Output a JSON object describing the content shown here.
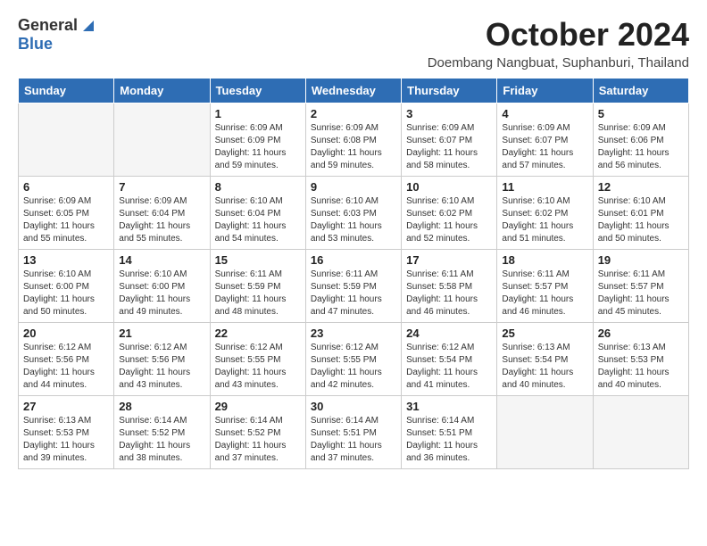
{
  "header": {
    "logo_general": "General",
    "logo_blue": "Blue",
    "month_title": "October 2024",
    "subtitle": "Doembang Nangbuat, Suphanburi, Thailand"
  },
  "weekdays": [
    "Sunday",
    "Monday",
    "Tuesday",
    "Wednesday",
    "Thursday",
    "Friday",
    "Saturday"
  ],
  "weeks": [
    [
      {
        "day": "",
        "info": ""
      },
      {
        "day": "",
        "info": ""
      },
      {
        "day": "1",
        "info": "Sunrise: 6:09 AM\nSunset: 6:09 PM\nDaylight: 11 hours\nand 59 minutes."
      },
      {
        "day": "2",
        "info": "Sunrise: 6:09 AM\nSunset: 6:08 PM\nDaylight: 11 hours\nand 59 minutes."
      },
      {
        "day": "3",
        "info": "Sunrise: 6:09 AM\nSunset: 6:07 PM\nDaylight: 11 hours\nand 58 minutes."
      },
      {
        "day": "4",
        "info": "Sunrise: 6:09 AM\nSunset: 6:07 PM\nDaylight: 11 hours\nand 57 minutes."
      },
      {
        "day": "5",
        "info": "Sunrise: 6:09 AM\nSunset: 6:06 PM\nDaylight: 11 hours\nand 56 minutes."
      }
    ],
    [
      {
        "day": "6",
        "info": "Sunrise: 6:09 AM\nSunset: 6:05 PM\nDaylight: 11 hours\nand 55 minutes."
      },
      {
        "day": "7",
        "info": "Sunrise: 6:09 AM\nSunset: 6:04 PM\nDaylight: 11 hours\nand 55 minutes."
      },
      {
        "day": "8",
        "info": "Sunrise: 6:10 AM\nSunset: 6:04 PM\nDaylight: 11 hours\nand 54 minutes."
      },
      {
        "day": "9",
        "info": "Sunrise: 6:10 AM\nSunset: 6:03 PM\nDaylight: 11 hours\nand 53 minutes."
      },
      {
        "day": "10",
        "info": "Sunrise: 6:10 AM\nSunset: 6:02 PM\nDaylight: 11 hours\nand 52 minutes."
      },
      {
        "day": "11",
        "info": "Sunrise: 6:10 AM\nSunset: 6:02 PM\nDaylight: 11 hours\nand 51 minutes."
      },
      {
        "day": "12",
        "info": "Sunrise: 6:10 AM\nSunset: 6:01 PM\nDaylight: 11 hours\nand 50 minutes."
      }
    ],
    [
      {
        "day": "13",
        "info": "Sunrise: 6:10 AM\nSunset: 6:00 PM\nDaylight: 11 hours\nand 50 minutes."
      },
      {
        "day": "14",
        "info": "Sunrise: 6:10 AM\nSunset: 6:00 PM\nDaylight: 11 hours\nand 49 minutes."
      },
      {
        "day": "15",
        "info": "Sunrise: 6:11 AM\nSunset: 5:59 PM\nDaylight: 11 hours\nand 48 minutes."
      },
      {
        "day": "16",
        "info": "Sunrise: 6:11 AM\nSunset: 5:59 PM\nDaylight: 11 hours\nand 47 minutes."
      },
      {
        "day": "17",
        "info": "Sunrise: 6:11 AM\nSunset: 5:58 PM\nDaylight: 11 hours\nand 46 minutes."
      },
      {
        "day": "18",
        "info": "Sunrise: 6:11 AM\nSunset: 5:57 PM\nDaylight: 11 hours\nand 46 minutes."
      },
      {
        "day": "19",
        "info": "Sunrise: 6:11 AM\nSunset: 5:57 PM\nDaylight: 11 hours\nand 45 minutes."
      }
    ],
    [
      {
        "day": "20",
        "info": "Sunrise: 6:12 AM\nSunset: 5:56 PM\nDaylight: 11 hours\nand 44 minutes."
      },
      {
        "day": "21",
        "info": "Sunrise: 6:12 AM\nSunset: 5:56 PM\nDaylight: 11 hours\nand 43 minutes."
      },
      {
        "day": "22",
        "info": "Sunrise: 6:12 AM\nSunset: 5:55 PM\nDaylight: 11 hours\nand 43 minutes."
      },
      {
        "day": "23",
        "info": "Sunrise: 6:12 AM\nSunset: 5:55 PM\nDaylight: 11 hours\nand 42 minutes."
      },
      {
        "day": "24",
        "info": "Sunrise: 6:12 AM\nSunset: 5:54 PM\nDaylight: 11 hours\nand 41 minutes."
      },
      {
        "day": "25",
        "info": "Sunrise: 6:13 AM\nSunset: 5:54 PM\nDaylight: 11 hours\nand 40 minutes."
      },
      {
        "day": "26",
        "info": "Sunrise: 6:13 AM\nSunset: 5:53 PM\nDaylight: 11 hours\nand 40 minutes."
      }
    ],
    [
      {
        "day": "27",
        "info": "Sunrise: 6:13 AM\nSunset: 5:53 PM\nDaylight: 11 hours\nand 39 minutes."
      },
      {
        "day": "28",
        "info": "Sunrise: 6:14 AM\nSunset: 5:52 PM\nDaylight: 11 hours\nand 38 minutes."
      },
      {
        "day": "29",
        "info": "Sunrise: 6:14 AM\nSunset: 5:52 PM\nDaylight: 11 hours\nand 37 minutes."
      },
      {
        "day": "30",
        "info": "Sunrise: 6:14 AM\nSunset: 5:51 PM\nDaylight: 11 hours\nand 37 minutes."
      },
      {
        "day": "31",
        "info": "Sunrise: 6:14 AM\nSunset: 5:51 PM\nDaylight: 11 hours\nand 36 minutes."
      },
      {
        "day": "",
        "info": ""
      },
      {
        "day": "",
        "info": ""
      }
    ]
  ]
}
